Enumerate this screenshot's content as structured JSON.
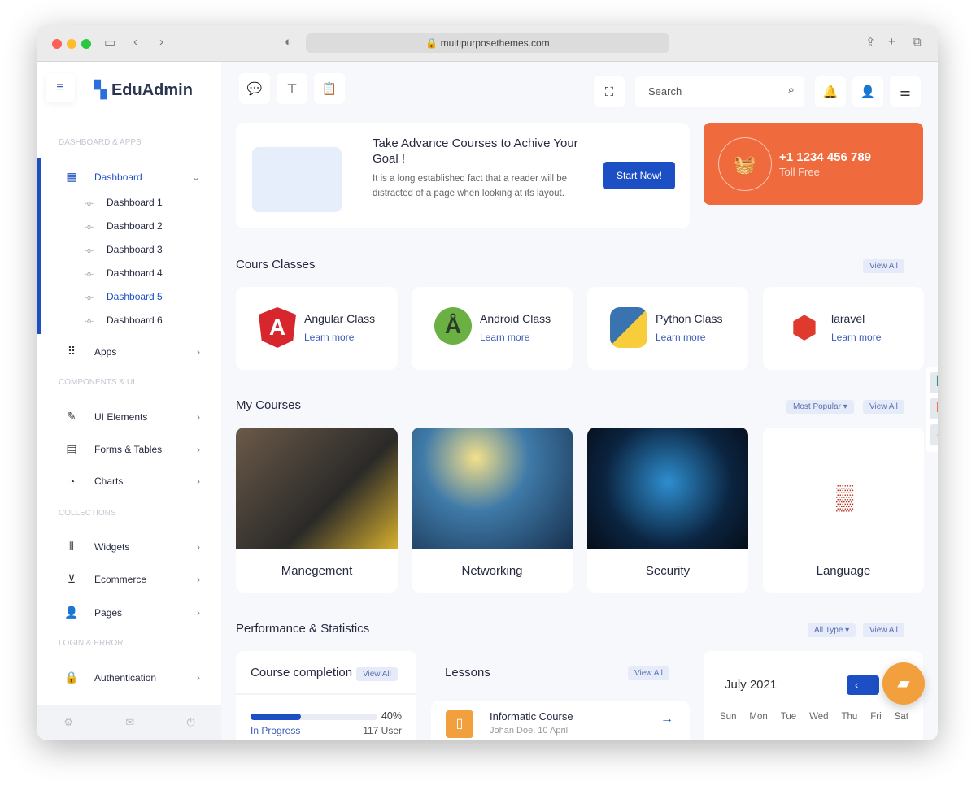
{
  "browser": {
    "url": "multipurposethemes.com"
  },
  "brand": "EduAdmin",
  "sidebar": {
    "sections": [
      "DASHBOARD & APPS",
      "COMPONENTS & UI",
      "COLLECTIONS",
      "LOGIN & ERROR"
    ],
    "dashboard": "Dashboard",
    "subitems": [
      "Dashboard 1",
      "Dashboard 2",
      "Dashboard 3",
      "Dashboard 4",
      "Dashboard 5",
      "Dashboard 6"
    ],
    "items": [
      "Apps",
      "UI Elements",
      "Forms & Tables",
      "Charts",
      "Widgets",
      "Ecommerce",
      "Pages",
      "Authentication"
    ]
  },
  "search": {
    "placeholder": "Search"
  },
  "banner": {
    "title": "Take Advance Courses to Achive Your Goal !",
    "text": "It is a long established fact that a reader will be distracted of a page when looking at its layout.",
    "button": "Start Now!"
  },
  "contact": {
    "phone": "+1 1234 456 789",
    "label": "Toll Free",
    "color": "#ef6a3d"
  },
  "classes": {
    "title": "Cours Classes",
    "view_all": "View All",
    "items": [
      {
        "name": "Angular Class",
        "link": "Learn more"
      },
      {
        "name": "Android Class",
        "link": "Learn more"
      },
      {
        "name": "Python Class",
        "link": "Learn more"
      },
      {
        "name": "laravel",
        "link": "Learn more"
      }
    ]
  },
  "my_courses": {
    "title": "My Courses",
    "filter": "Most Popular",
    "view_all": "View All",
    "items": [
      "Manegement",
      "Networking",
      "Security",
      "Language"
    ]
  },
  "perf": {
    "title": "Performance & Statistics",
    "filter": "All Type",
    "view_all": "View All"
  },
  "completion": {
    "title": "Course completion",
    "view_all": "View All",
    "percent": "40%",
    "progress": 40,
    "status": "In Progress",
    "users": "117 User"
  },
  "lessons": {
    "title": "Lessons",
    "view_all": "View All",
    "item": "Informatic Course",
    "sub": "Johan Doe, 10 April"
  },
  "calendar": {
    "month": "July 2021",
    "days": [
      "Sun",
      "Mon",
      "Tue",
      "Wed",
      "Thu",
      "Fri",
      "Sat"
    ]
  },
  "accent": "#1d4fc4"
}
